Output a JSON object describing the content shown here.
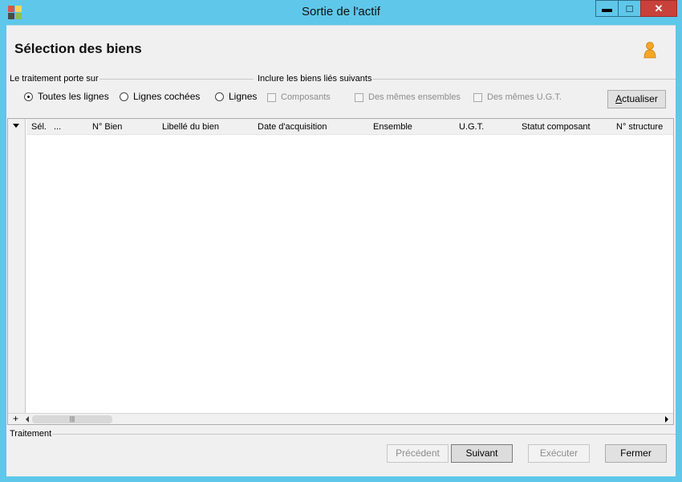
{
  "window": {
    "title": "Sortie de l'actif",
    "controls": {
      "minimize": "▬",
      "maximize": "□",
      "close": "✕"
    },
    "accent_color": "#5fc7ea",
    "close_color": "#c8413a"
  },
  "header": {
    "title": "Sélection des biens",
    "user_icon": "user-icon"
  },
  "scope_group": {
    "label": "Le traitement porte sur",
    "options": [
      {
        "label": "Toutes les lignes",
        "selected": true
      },
      {
        "label": "Lignes cochées",
        "selected": false
      },
      {
        "label": "Lignes",
        "selected": false
      }
    ]
  },
  "include_group": {
    "label": "Inclure les biens liés suivants",
    "options": [
      {
        "label": "Composants",
        "checked": false,
        "enabled": false
      },
      {
        "label": "Des mêmes ensembles",
        "checked": false,
        "enabled": false
      },
      {
        "label": "Des mêmes U.G.T.",
        "checked": false,
        "enabled": false
      }
    ]
  },
  "refresh_button": "Actualiser",
  "grid": {
    "columns": [
      "Sél.",
      "...",
      "N° Bien",
      "Libellé du bien",
      "Date d'acquisition",
      "Ensemble",
      "U.G.T.",
      "Statut composant",
      "N° structure"
    ],
    "rows": [],
    "add_row": "+",
    "scroll_grip": "|||"
  },
  "footer": {
    "section_label": "Traitement",
    "buttons": [
      {
        "label": "Précédent",
        "enabled": false
      },
      {
        "label": "Suivant",
        "enabled": true
      },
      {
        "label": "Exécuter",
        "enabled": false
      },
      {
        "label": "Fermer",
        "enabled": true
      }
    ]
  }
}
